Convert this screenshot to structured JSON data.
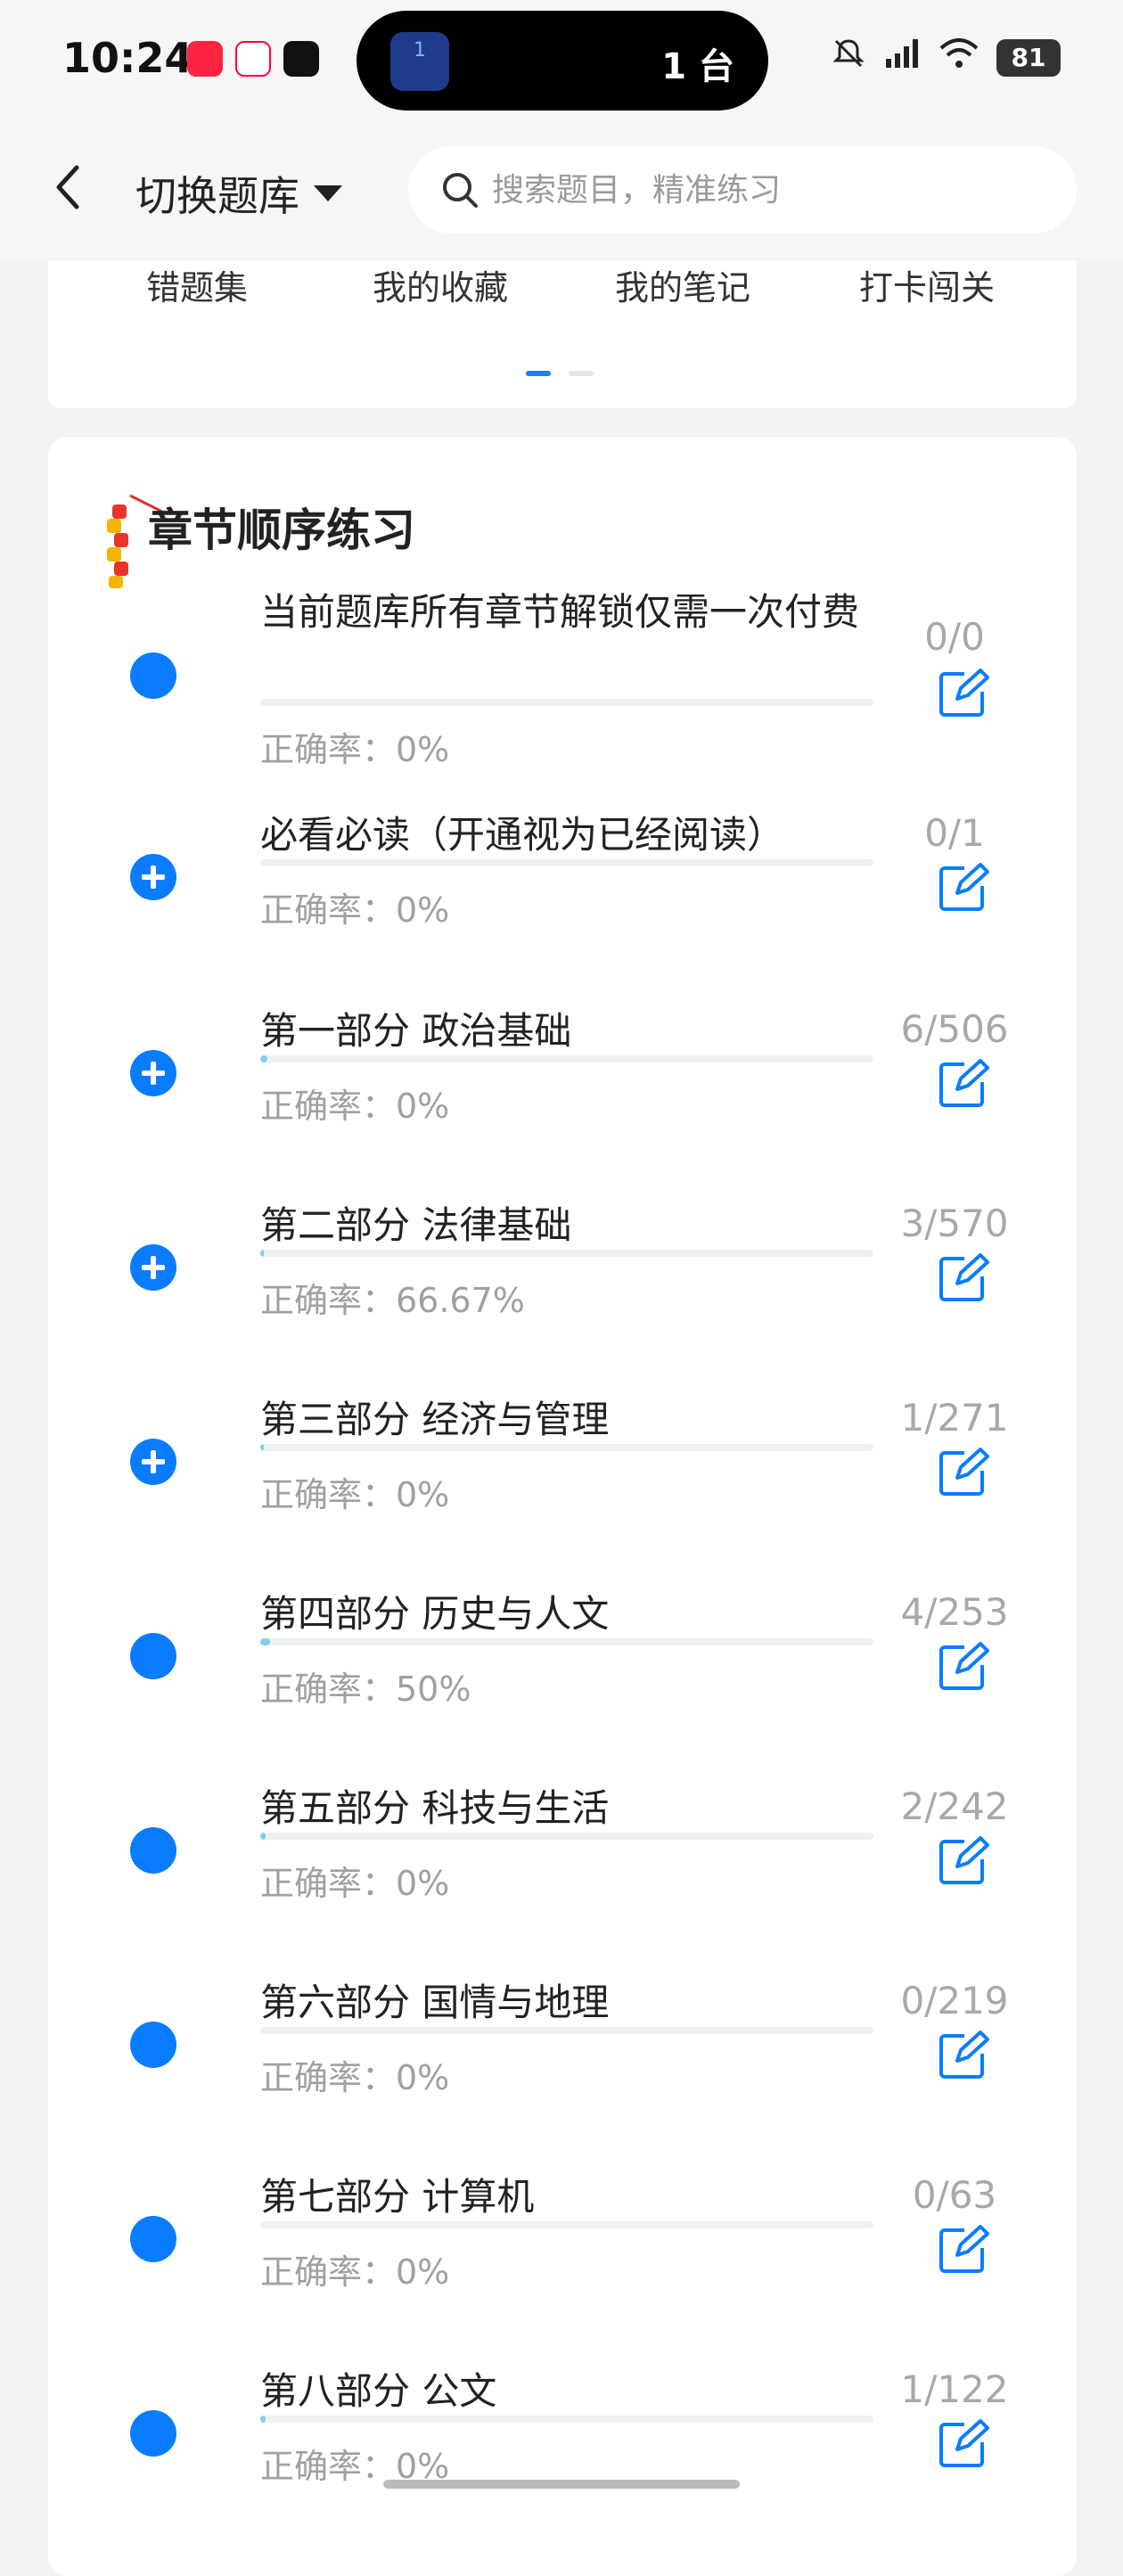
{
  "status_bar": {
    "time": "10:24",
    "island_badge": "1",
    "island_text": "1 台",
    "battery": "81"
  },
  "navbar": {
    "title": "切换题库",
    "search_placeholder": "搜索题目，精准练习"
  },
  "tools": {
    "items": [
      "错题集",
      "我的收藏",
      "我的笔记",
      "打卡闯关"
    ]
  },
  "chapter_section": {
    "title": "章节顺序练习",
    "chapters": [
      {
        "name": "当前题库所有章节解锁仅需一次付费",
        "accuracy": "正确率：0%",
        "count": "0/0",
        "progress": 0,
        "icon": "dot-icon"
      },
      {
        "name": "必看必读（开通视为已经阅读）",
        "accuracy": "正确率：0%",
        "count": "0/1",
        "progress": 0,
        "icon": "plus-icon"
      },
      {
        "name": "第一部分 政治基础",
        "accuracy": "正确率：0%",
        "count": "6/506",
        "progress": 0.012,
        "icon": "plus-icon"
      },
      {
        "name": "第二部分 法律基础",
        "accuracy": "正确率：66.67%",
        "count": "3/570",
        "progress": 0.005,
        "icon": "plus-icon"
      },
      {
        "name": "第三部分 经济与管理",
        "accuracy": "正确率：0%",
        "count": "1/271",
        "progress": 0.004,
        "icon": "plus-icon"
      },
      {
        "name": "第四部分 历史与人文",
        "accuracy": "正确率：50%",
        "count": "4/253",
        "progress": 0.016,
        "icon": "dot-icon"
      },
      {
        "name": "第五部分 科技与生活",
        "accuracy": "正确率：0%",
        "count": "2/242",
        "progress": 0.008,
        "icon": "dot-icon"
      },
      {
        "name": "第六部分 国情与地理",
        "accuracy": "正确率：0%",
        "count": "0/219",
        "progress": 0,
        "icon": "dot-icon"
      },
      {
        "name": "第七部分 计算机",
        "accuracy": "正确率：0%",
        "count": "0/63",
        "progress": 0,
        "icon": "dot-icon"
      },
      {
        "name": "第八部分 公文",
        "accuracy": "正确率：0%",
        "count": "1/122",
        "progress": 0.008,
        "icon": "dot-icon"
      }
    ]
  },
  "colors": {
    "accent": "#0a7cff",
    "progress": "#7fd0f0",
    "muted_text": "#a0a0a0"
  }
}
